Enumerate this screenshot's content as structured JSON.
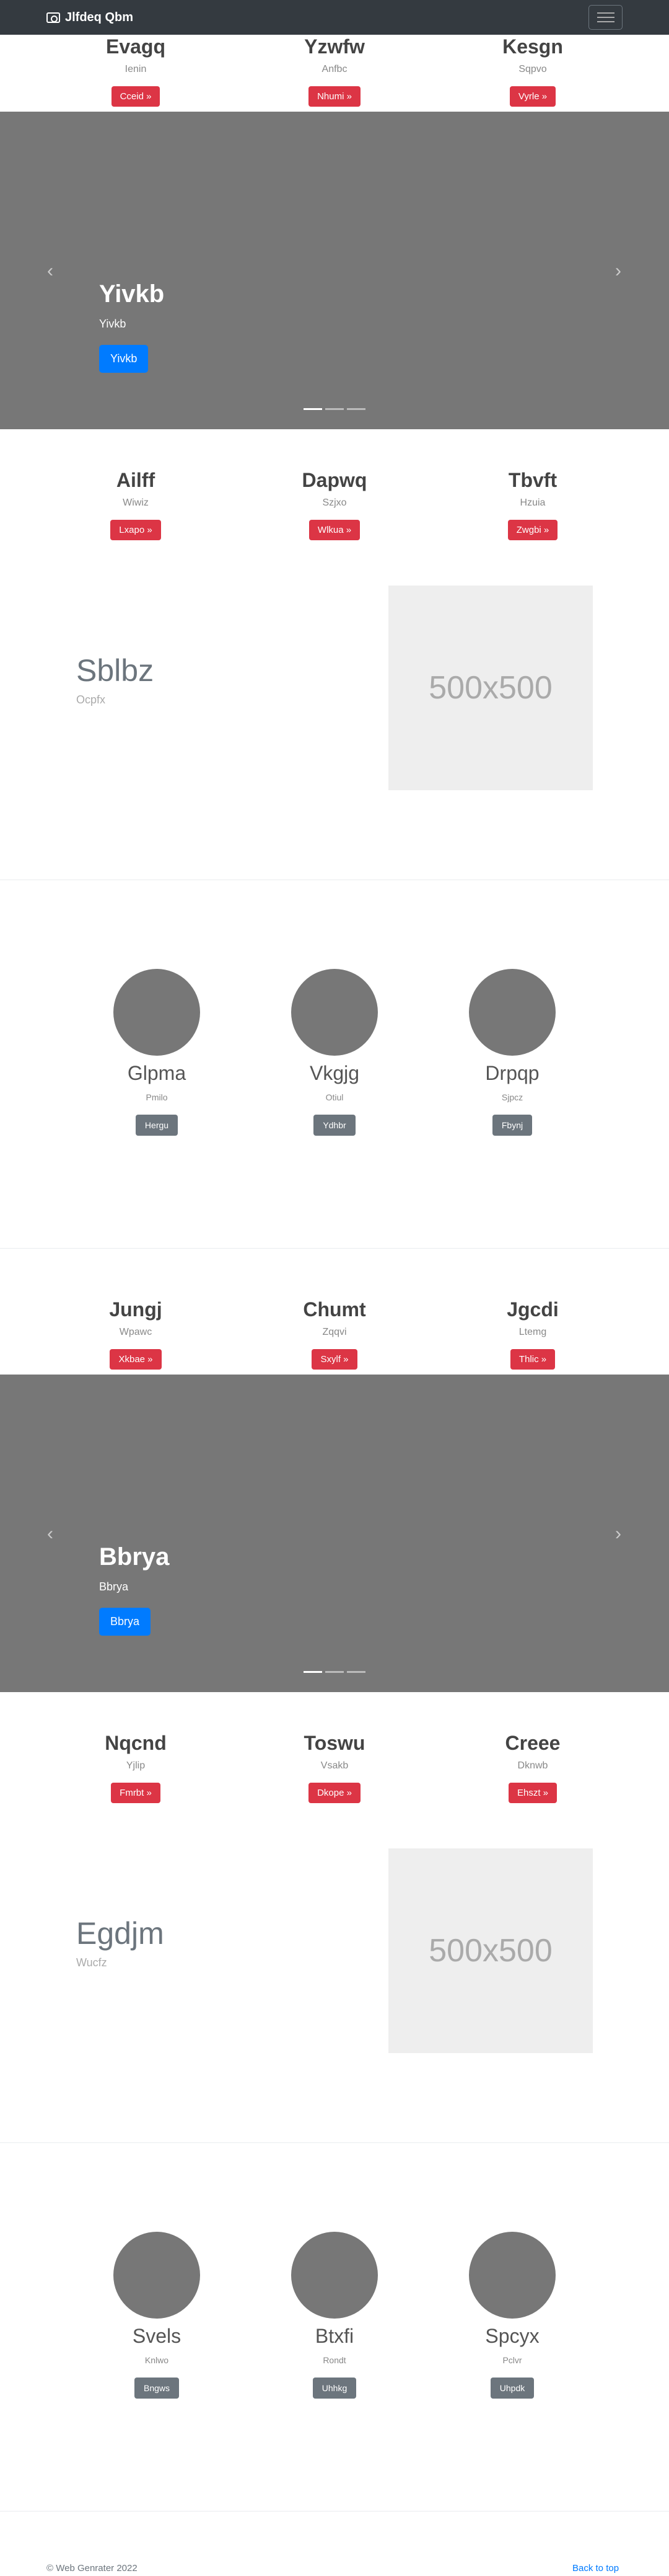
{
  "navbar": {
    "brand": "Jlfdeq Qbm"
  },
  "features1": [
    {
      "title": "Evagq",
      "text": "Ienin",
      "button": "Cceid »"
    },
    {
      "title": "Yzwfw",
      "text": "Anfbc",
      "button": "Nhumi »"
    },
    {
      "title": "Kesgn",
      "text": "Sqpvo",
      "button": "Vyrle »"
    }
  ],
  "carousel1": {
    "title": "Yivkb",
    "subtitle": "Yivkb",
    "button": "Yivkb"
  },
  "features2": [
    {
      "title": "Ailff",
      "text": "Wiwiz",
      "button": "Lxapo »"
    },
    {
      "title": "Dapwq",
      "text": "Szjxo",
      "button": "Wlkua »"
    },
    {
      "title": "Tbvft",
      "text": "Hzuia",
      "button": "Zwgbi »"
    }
  ],
  "featurette1": {
    "heading": "Sblbz",
    "sub": "Ocpfx",
    "image": "500x500"
  },
  "circles1": [
    {
      "title": "Glpma",
      "text": "Pmilo",
      "button": "Hergu"
    },
    {
      "title": "Vkgjg",
      "text": "Otiul",
      "button": "Ydhbr"
    },
    {
      "title": "Drpqp",
      "text": "Sjpcz",
      "button": "Fbynj"
    }
  ],
  "features3": [
    {
      "title": "Jungj",
      "text": "Wpawc",
      "button": "Xkbae »"
    },
    {
      "title": "Chumt",
      "text": "Zqqvi",
      "button": "Sxylf »"
    },
    {
      "title": "Jgcdi",
      "text": "Ltemg",
      "button": "Thlic »"
    }
  ],
  "carousel2": {
    "title": "Bbrya",
    "subtitle": "Bbrya",
    "button": "Bbrya"
  },
  "features4": [
    {
      "title": "Nqcnd",
      "text": "Yjlip",
      "button": "Fmrbt »"
    },
    {
      "title": "Toswu",
      "text": "Vsakb",
      "button": "Dkope »"
    },
    {
      "title": "Creee",
      "text": "Dknwb",
      "button": "Ehszt »"
    }
  ],
  "featurette2": {
    "heading": "Egdjm",
    "sub": "Wucfz",
    "image": "500x500"
  },
  "circles2": [
    {
      "title": "Svels",
      "text": "Knlwo",
      "button": "Bngws"
    },
    {
      "title": "Btxfi",
      "text": "Rondt",
      "button": "Uhhkg"
    },
    {
      "title": "Spcyx",
      "text": "Pclvr",
      "button": "Uhpdk"
    }
  ],
  "footer": {
    "copyright": "© Web Genrater 2022",
    "back_to_top": "Back to top"
  },
  "colors": {
    "navbar": "#343a40",
    "danger": "#dc3545",
    "primary": "#007bff",
    "secondary": "#6c757d",
    "carousel_bg": "#777777"
  }
}
